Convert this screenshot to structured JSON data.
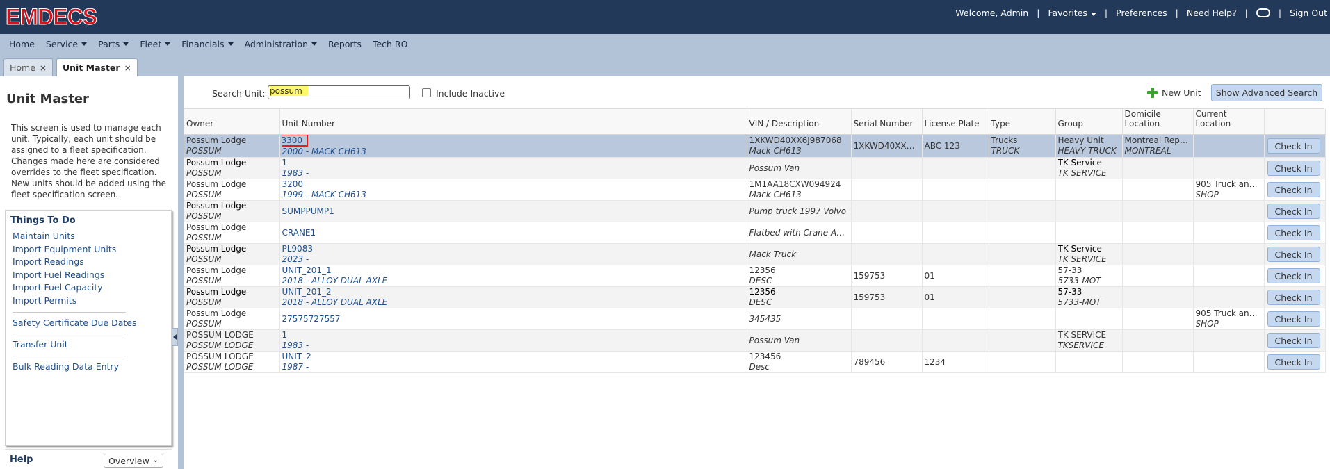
{
  "header": {
    "logo": "EMDECS",
    "welcome": "Welcome, Admin",
    "favorites": "Favorites",
    "preferences": "Preferences",
    "need_help": "Need Help?",
    "sign_out": "Sign Out",
    "separator": "|"
  },
  "menu": [
    "Home",
    "Service",
    "Parts",
    "Fleet",
    "Financials",
    "Administration",
    "Reports",
    "Tech RO"
  ],
  "tabs": [
    {
      "label": "Home",
      "close": "×"
    },
    {
      "label": "Unit Master",
      "close": "×"
    }
  ],
  "sidebar": {
    "title": "Unit Master",
    "description": "This screen is used to manage each unit. Typically, each unit should be assigned to a fleet specification. Changes made here are considered overrides to the fleet specification. New units should be added using the fleet specification screen.",
    "todo_title": "Things To Do",
    "todo_group1": [
      "Maintain Units",
      "Import Equipment Units",
      "Import Readings",
      "Import Fuel Readings",
      "Import Fuel Capacity",
      "Import Permits"
    ],
    "todo_group2": [
      "Safety Certificate Due Dates"
    ],
    "todo_group3": [
      "Transfer Unit"
    ],
    "todo_group4": [
      "Bulk Reading Data Entry"
    ],
    "help_title": "Help",
    "help_select": "Overview"
  },
  "search": {
    "label": "Search Unit:",
    "value": "possum",
    "include_inactive": "Include Inactive",
    "new_unit": "New Unit",
    "advanced": "Show Advanced Search"
  },
  "grid": {
    "columns": [
      "Owner",
      "Unit Number",
      "VIN / Description",
      "Serial Number",
      "License Plate",
      "Type",
      "Group",
      "Domicile Location",
      "Current Location",
      ""
    ],
    "button_label": "Check In",
    "rows": [
      {
        "owner": [
          "Possum Lodge",
          "POSSUM"
        ],
        "unit": [
          "3300",
          "2000 - MACK CH613"
        ],
        "vin": [
          "1XKWD40XX6J987068",
          "Mack CH613"
        ],
        "serial": "1XKWD40XX6...",
        "plate": "ABC 123",
        "type": [
          "Trucks",
          "TRUCK"
        ],
        "group": [
          "Heavy Unit",
          "HEAVY TRUCK"
        ],
        "domicile": [
          "Montreal Repa...",
          "MONTREAL"
        ],
        "current": [
          "",
          ""
        ]
      },
      {
        "owner": [
          "Possum Lodge",
          "POSSUM"
        ],
        "unit": [
          "1",
          "1983 -"
        ],
        "vin": [
          "",
          "Possum Van"
        ],
        "serial": "",
        "plate": "",
        "type": [
          "",
          ""
        ],
        "group": [
          "TK Service",
          "TK SERVICE"
        ],
        "domicile": [
          "",
          ""
        ],
        "current": [
          "",
          ""
        ]
      },
      {
        "owner": [
          "Possum Lodge",
          "POSSUM"
        ],
        "unit": [
          "3200",
          "1999 - MACK CH613"
        ],
        "vin": [
          "1M1AA18CXW094924",
          "Mack CH613"
        ],
        "serial": "",
        "plate": "",
        "type": [
          "",
          ""
        ],
        "group": [
          "",
          ""
        ],
        "domicile": [
          "",
          ""
        ],
        "current": [
          "905 Truck and...",
          "SHOP"
        ]
      },
      {
        "owner": [
          "Possum Lodge",
          "POSSUM"
        ],
        "unit": [
          "SUMPPUMP1",
          ""
        ],
        "vin": [
          "",
          "Pump truck 1997 Volvo"
        ],
        "serial": "",
        "plate": "",
        "type": [
          "",
          ""
        ],
        "group": [
          "",
          ""
        ],
        "domicile": [
          "",
          ""
        ],
        "current": [
          "",
          ""
        ]
      },
      {
        "owner": [
          "Possum Lodge",
          "POSSUM"
        ],
        "unit": [
          "CRANE1",
          ""
        ],
        "vin": [
          "",
          "Flatbed with Crane Assm..."
        ],
        "serial": "",
        "plate": "",
        "type": [
          "",
          ""
        ],
        "group": [
          "",
          ""
        ],
        "domicile": [
          "",
          ""
        ],
        "current": [
          "",
          ""
        ]
      },
      {
        "owner": [
          "Possum Lodge",
          "POSSUM"
        ],
        "unit": [
          "PL9083",
          "2023 -"
        ],
        "vin": [
          "",
          "Mack Truck"
        ],
        "serial": "",
        "plate": "",
        "type": [
          "",
          ""
        ],
        "group": [
          "TK Service",
          "TK SERVICE"
        ],
        "domicile": [
          "",
          ""
        ],
        "current": [
          "",
          ""
        ]
      },
      {
        "owner": [
          "Possum Lodge",
          "POSSUM"
        ],
        "unit": [
          "UNIT_201_1",
          "2018 - ALLOY DUAL AXLE"
        ],
        "vin": [
          "12356",
          "DESC"
        ],
        "serial": "159753",
        "plate": "01",
        "type": [
          "",
          ""
        ],
        "group": [
          "57-33",
          "5733-MOT"
        ],
        "domicile": [
          "",
          ""
        ],
        "current": [
          "",
          ""
        ]
      },
      {
        "owner": [
          "Possum Lodge",
          "POSSUM"
        ],
        "unit": [
          "UNIT_201_2",
          "2018 - ALLOY DUAL AXLE"
        ],
        "vin": [
          "12356",
          "DESC"
        ],
        "serial": "159753",
        "plate": "01",
        "type": [
          "",
          ""
        ],
        "group": [
          "57-33",
          "5733-MOT"
        ],
        "domicile": [
          "",
          ""
        ],
        "current": [
          "",
          ""
        ]
      },
      {
        "owner": [
          "Possum Lodge",
          "POSSUM"
        ],
        "unit": [
          "27575727557",
          ""
        ],
        "vin": [
          "",
          "345435"
        ],
        "serial": "",
        "plate": "",
        "type": [
          "",
          ""
        ],
        "group": [
          "",
          ""
        ],
        "domicile": [
          "",
          ""
        ],
        "current": [
          "905 Truck and...",
          "SHOP"
        ]
      },
      {
        "owner": [
          "POSSUM LODGE",
          "POSSUM LODGE"
        ],
        "unit": [
          "1",
          "1983 -"
        ],
        "vin": [
          "",
          "Possum Van"
        ],
        "serial": "",
        "plate": "",
        "type": [
          "",
          ""
        ],
        "group": [
          "TK SERVICE",
          "TKSERVICE"
        ],
        "domicile": [
          "",
          ""
        ],
        "current": [
          "",
          ""
        ]
      },
      {
        "owner": [
          "POSSUM LODGE",
          "POSSUM LODGE"
        ],
        "unit": [
          "UNIT_2",
          "1987 -"
        ],
        "vin": [
          "123456",
          "Desc"
        ],
        "serial": "789456",
        "plate": "1234",
        "type": [
          "",
          ""
        ],
        "group": [
          "",
          ""
        ],
        "domicile": [
          "",
          ""
        ],
        "current": [
          "",
          ""
        ]
      }
    ]
  }
}
